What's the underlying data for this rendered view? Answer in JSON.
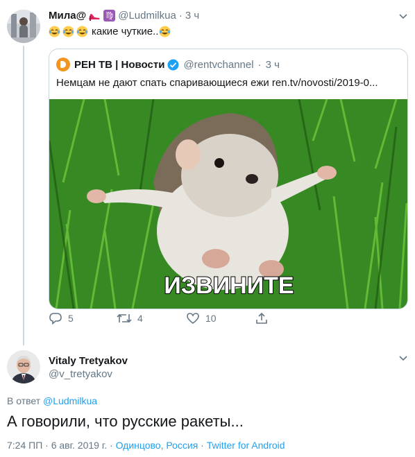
{
  "tweet1": {
    "display_name": "Мила@",
    "handle": "@Ludmilkua",
    "sep": "·",
    "time": "3 ч",
    "text": "какие чуткие..",
    "virgo_glyph": "♍",
    "icons": [
      "heel-emoji",
      "virgo-sign",
      "laughing-emoji",
      "more-options-chevron"
    ]
  },
  "quote": {
    "display_name": "РЕН ТВ | Новости",
    "handle": "@rentvchannel",
    "sep": "·",
    "time": "3 ч",
    "text": "Немцам не дают спать спаривающиеся ежи ren.tv/novosti/2019-0...",
    "image_caption": "ИЗВИНИТЕ"
  },
  "actions": {
    "replies": "5",
    "retweets": "4",
    "likes": "10"
  },
  "tweet2": {
    "display_name": "Vitaly Tretyakov",
    "handle": "@v_tretyakov",
    "reply_prefix": "В ответ",
    "reply_to": "@Ludmilkua",
    "text": "А говорили, что русские ракеты...",
    "timestamp": "7:24 ПП · 6 авг. 2019 г.",
    "location": "Одинцово, Россия",
    "source": "Twitter for Android",
    "sep": "·"
  },
  "colors": {
    "link": "#1da1f2",
    "meta": "#657786",
    "border": "#ccd6dd",
    "text": "#14171a",
    "virgo": "#9b59b6",
    "rentv_logo": "#f29623"
  }
}
